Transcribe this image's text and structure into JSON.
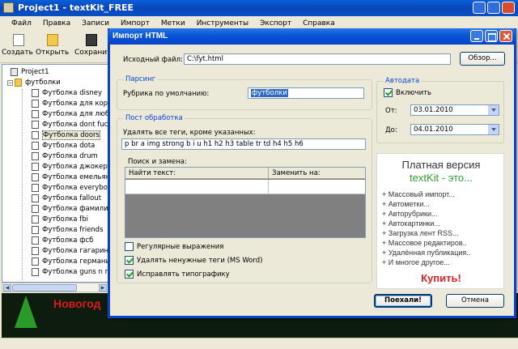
{
  "main_window": {
    "title": "Project1 - textKit_FREE",
    "menu": [
      "Файл",
      "Правка",
      "Записи",
      "Импорт",
      "Метки",
      "Инструменты",
      "Экспорт",
      "Справка"
    ],
    "toolbar": [
      {
        "label": "Создать",
        "icon": "new-document-icon"
      },
      {
        "label": "Открыть",
        "icon": "open-folder-icon"
      },
      {
        "label": "Сохранить",
        "icon": "save-disk-icon"
      }
    ],
    "tree": {
      "project": "Project1",
      "folder": "футболки",
      "items": [
        "Футболка disney",
        "Футболка для корм",
        "Футболка для люби",
        "Футболка dont fuck",
        "Футболка doors",
        "Футболка dota",
        "Футболка drum",
        "Футболка джокер",
        "Футболка емельян",
        "Футболка everybod",
        "Футболка fallout",
        "Футболка фамилия",
        "Футболка fbi",
        "Футболка friends",
        "Футболка фсб",
        "Футболка гагарин",
        "Футболка германи",
        "Футболка guns n ro"
      ],
      "selected_index": 4
    },
    "banner": {
      "text": "Новогод"
    }
  },
  "dialog": {
    "title": "Импорт HTML",
    "source_label": "Исходный файл:",
    "source_value": "C:\\fyt.html",
    "browse_label": "Обзор...",
    "parsing": {
      "title": "Парсинг",
      "rubric_label": "Рубрика по умолчанию:",
      "rubric_value": "футболки"
    },
    "postprocess": {
      "title": "Пост обработка",
      "remove_tags_label": "Удалять все теги, кроме указанных:",
      "allowed_tags": "p br a img strong b i u h1 h2 h3 table tr td h4 h5 h6",
      "search_replace_label": "Поиск и замена:",
      "col_find": "Найти текст:",
      "col_replace": "Заменить на:",
      "regex_label": "Регулярные выражения",
      "regex_checked": false,
      "msword_label": "Удалять ненужные теги (MS Word)",
      "msword_checked": true,
      "typography_label": "Исправлять типографику",
      "typography_checked": true
    },
    "autodate": {
      "title": "Автодата",
      "enable_label": "Включить",
      "enable_checked": true,
      "from_label": "От:",
      "from_value": "03.01.2010",
      "to_label": "До:",
      "to_value": "04.01.2010"
    },
    "promo": {
      "line1": "Платная версия",
      "brand": "textKit",
      "brand_suffix": " - это...",
      "features": [
        "+ Массовый импорт...",
        "+ Автометки...",
        "+ Авторубрики...",
        "+ Автокартинки...",
        "+ Загрузка лент RSS...",
        "+ Массовое редактиров..",
        "+ Удалённая публикация..",
        "+ И многое другое..."
      ],
      "buy_label": "Купить!",
      "colors": {
        "brand": "#2e9e2e",
        "buy": "#e02020"
      }
    },
    "ok_label": "Поехали!",
    "cancel_label": "Отмена"
  }
}
